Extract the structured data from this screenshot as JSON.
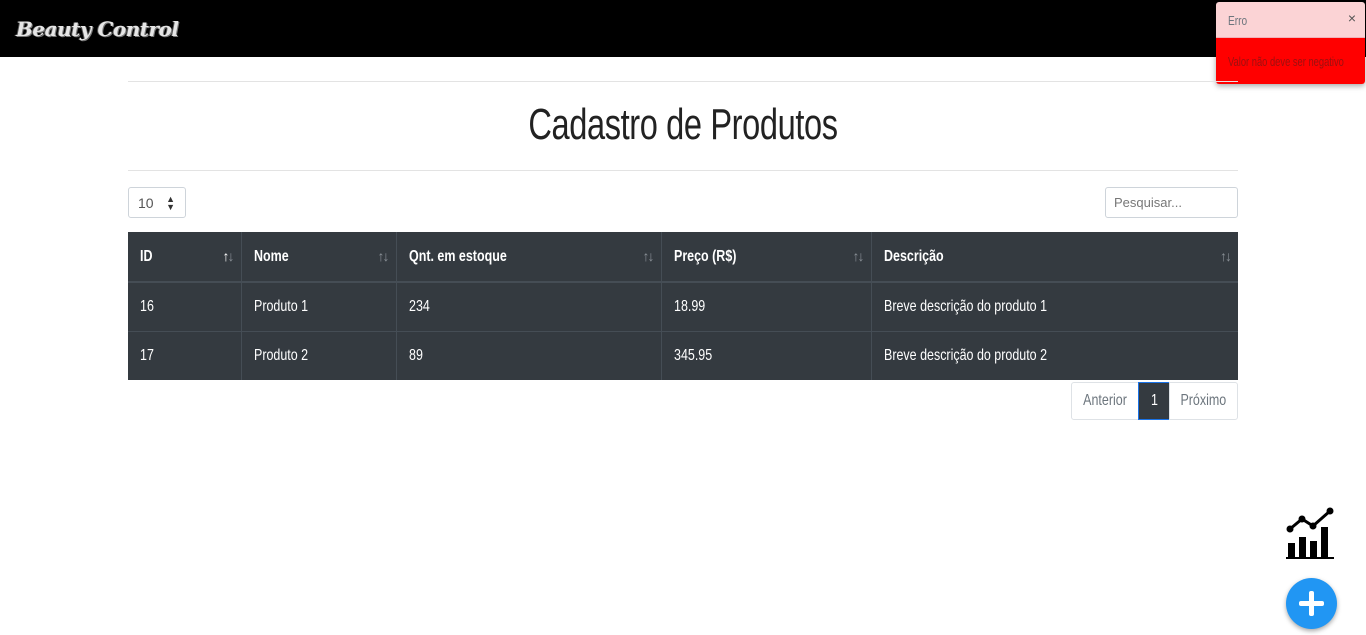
{
  "app": {
    "brand": "Beauty Control"
  },
  "toast": {
    "title": "Erro",
    "close": "×",
    "message": "Valor não deve ser negativo"
  },
  "page": {
    "title": "Cadastro de Produtos"
  },
  "controls": {
    "page_length": "10",
    "search_placeholder": "Pesquisar..."
  },
  "table": {
    "columns": [
      "ID",
      "Nome",
      "Qnt. em estoque",
      "Preço (R$)",
      "Descrição"
    ],
    "sort_glyph": "↑↓",
    "rows": [
      [
        "16",
        "Produto 1",
        "234",
        "18.99",
        "Breve descrição do produto 1"
      ],
      [
        "17",
        "Produto 2",
        "89",
        "345.95",
        "Breve descrição do produto 2"
      ]
    ]
  },
  "pagination": {
    "previous": "Anterior",
    "current": "1",
    "next": "Próximo"
  },
  "floating": {
    "chart_icon": "chart-line-icon",
    "add_icon": "plus-icon"
  },
  "colors": {
    "navbar": "#000000",
    "table_bg": "#343a40",
    "toast_body": "#ff0000",
    "add_button": "#2196f3"
  }
}
